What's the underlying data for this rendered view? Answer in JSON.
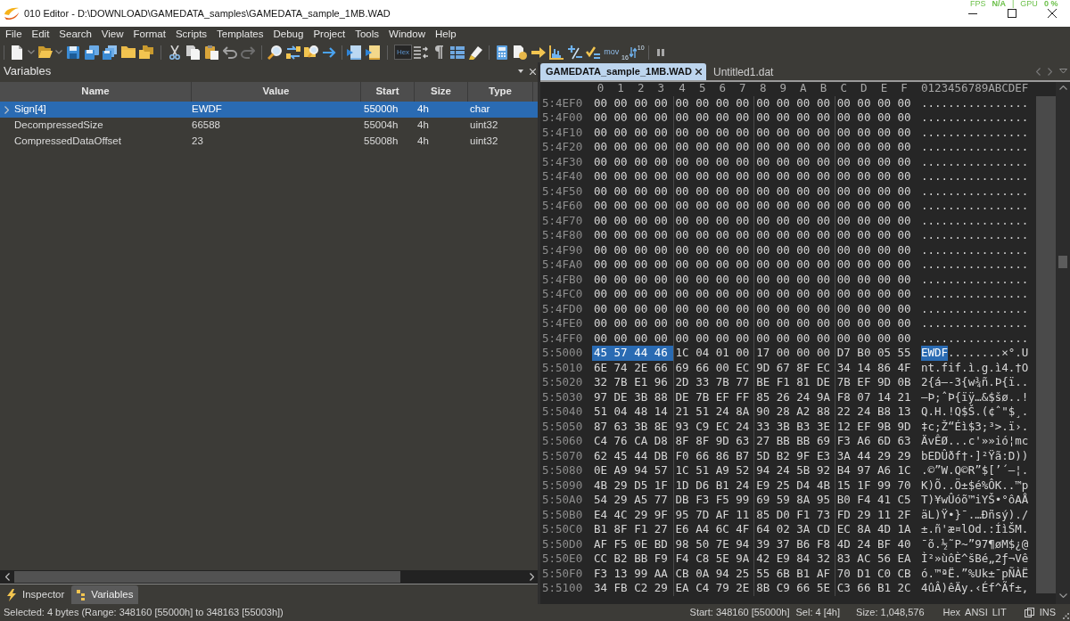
{
  "window": {
    "title": "010 Editor - D:\\DOWNLOAD\\GAMEDATA_samples\\GAMEDATA_sample_1MB.WAD"
  },
  "overlay": {
    "stats": [
      {
        "label": "FPS",
        "value": "N/A"
      },
      {
        "label": "GPU",
        "value": "0 %"
      }
    ],
    "separator": "|"
  },
  "menu": [
    "File",
    "Edit",
    "Search",
    "View",
    "Format",
    "Scripts",
    "Templates",
    "Debug",
    "Project",
    "Tools",
    "Window",
    "Help"
  ],
  "toolbar": {
    "hex_toggle": {
      "label": "Hex",
      "on": true
    },
    "mov_label": "mov",
    "base_labels": [
      "10",
      "16"
    ]
  },
  "variables_panel": {
    "title": "Variables",
    "columns": [
      "Name",
      "Value",
      "Start",
      "Size",
      "Type"
    ],
    "rows": [
      {
        "name": "Sign[4]",
        "value": "EWDF",
        "start": "55000h",
        "size": "4h",
        "type": "char",
        "expandable": true,
        "selected": true
      },
      {
        "name": "DecompressedSize",
        "value": "66588",
        "start": "55004h",
        "size": "4h",
        "type": "uint32",
        "expandable": false,
        "selected": false
      },
      {
        "name": "CompressedDataOffset",
        "value": "23",
        "start": "55008h",
        "size": "4h",
        "type": "uint32",
        "expandable": false,
        "selected": false
      }
    ]
  },
  "bottom_tabs": [
    {
      "label": "Inspector",
      "selected": false
    },
    {
      "label": "Variables",
      "selected": true
    }
  ],
  "editor_tabs": [
    {
      "label": "GAMEDATA_sample_1MB.WAD",
      "selected": true
    },
    {
      "label": "Untitled1.dat",
      "selected": false
    }
  ],
  "hex_view": {
    "column_headers": [
      "0",
      "1",
      "2",
      "3",
      "4",
      "5",
      "6",
      "7",
      "8",
      "9",
      "A",
      "B",
      "C",
      "D",
      "E",
      "F"
    ],
    "ascii_header": "0123456789ABCDEF",
    "rows": [
      {
        "address": "5:4EF0",
        "hex": [
          {
            "text": "00 00 00 00",
            "selected": false
          },
          {
            "text": "00 00 00 00",
            "selected": false
          },
          {
            "text": "00 00 00 00",
            "selected": false
          },
          {
            "text": "00 00 00 00",
            "selected": false
          }
        ],
        "ascii": [
          {
            "text": "................",
            "selected": false
          }
        ]
      },
      {
        "address": "5:4F00",
        "hex": [
          {
            "text": "00 00 00 00",
            "selected": false
          },
          {
            "text": "00 00 00 00",
            "selected": false
          },
          {
            "text": "00 00 00 00",
            "selected": false
          },
          {
            "text": "00 00 00 00",
            "selected": false
          }
        ],
        "ascii": [
          {
            "text": "................",
            "selected": false
          }
        ]
      },
      {
        "address": "5:4F10",
        "hex": [
          {
            "text": "00 00 00 00",
            "selected": false
          },
          {
            "text": "00 00 00 00",
            "selected": false
          },
          {
            "text": "00 00 00 00",
            "selected": false
          },
          {
            "text": "00 00 00 00",
            "selected": false
          }
        ],
        "ascii": [
          {
            "text": "................",
            "selected": false
          }
        ]
      },
      {
        "address": "5:4F20",
        "hex": [
          {
            "text": "00 00 00 00",
            "selected": false
          },
          {
            "text": "00 00 00 00",
            "selected": false
          },
          {
            "text": "00 00 00 00",
            "selected": false
          },
          {
            "text": "00 00 00 00",
            "selected": false
          }
        ],
        "ascii": [
          {
            "text": "................",
            "selected": false
          }
        ]
      },
      {
        "address": "5:4F30",
        "hex": [
          {
            "text": "00 00 00 00",
            "selected": false
          },
          {
            "text": "00 00 00 00",
            "selected": false
          },
          {
            "text": "00 00 00 00",
            "selected": false
          },
          {
            "text": "00 00 00 00",
            "selected": false
          }
        ],
        "ascii": [
          {
            "text": "................",
            "selected": false
          }
        ]
      },
      {
        "address": "5:4F40",
        "hex": [
          {
            "text": "00 00 00 00",
            "selected": false
          },
          {
            "text": "00 00 00 00",
            "selected": false
          },
          {
            "text": "00 00 00 00",
            "selected": false
          },
          {
            "text": "00 00 00 00",
            "selected": false
          }
        ],
        "ascii": [
          {
            "text": "................",
            "selected": false
          }
        ]
      },
      {
        "address": "5:4F50",
        "hex": [
          {
            "text": "00 00 00 00",
            "selected": false
          },
          {
            "text": "00 00 00 00",
            "selected": false
          },
          {
            "text": "00 00 00 00",
            "selected": false
          },
          {
            "text": "00 00 00 00",
            "selected": false
          }
        ],
        "ascii": [
          {
            "text": "................",
            "selected": false
          }
        ]
      },
      {
        "address": "5:4F60",
        "hex": [
          {
            "text": "00 00 00 00",
            "selected": false
          },
          {
            "text": "00 00 00 00",
            "selected": false
          },
          {
            "text": "00 00 00 00",
            "selected": false
          },
          {
            "text": "00 00 00 00",
            "selected": false
          }
        ],
        "ascii": [
          {
            "text": "................",
            "selected": false
          }
        ]
      },
      {
        "address": "5:4F70",
        "hex": [
          {
            "text": "00 00 00 00",
            "selected": false
          },
          {
            "text": "00 00 00 00",
            "selected": false
          },
          {
            "text": "00 00 00 00",
            "selected": false
          },
          {
            "text": "00 00 00 00",
            "selected": false
          }
        ],
        "ascii": [
          {
            "text": "................",
            "selected": false
          }
        ]
      },
      {
        "address": "5:4F80",
        "hex": [
          {
            "text": "00 00 00 00",
            "selected": false
          },
          {
            "text": "00 00 00 00",
            "selected": false
          },
          {
            "text": "00 00 00 00",
            "selected": false
          },
          {
            "text": "00 00 00 00",
            "selected": false
          }
        ],
        "ascii": [
          {
            "text": "................",
            "selected": false
          }
        ]
      },
      {
        "address": "5:4F90",
        "hex": [
          {
            "text": "00 00 00 00",
            "selected": false
          },
          {
            "text": "00 00 00 00",
            "selected": false
          },
          {
            "text": "00 00 00 00",
            "selected": false
          },
          {
            "text": "00 00 00 00",
            "selected": false
          }
        ],
        "ascii": [
          {
            "text": "................",
            "selected": false
          }
        ]
      },
      {
        "address": "5:4FA0",
        "hex": [
          {
            "text": "00 00 00 00",
            "selected": false
          },
          {
            "text": "00 00 00 00",
            "selected": false
          },
          {
            "text": "00 00 00 00",
            "selected": false
          },
          {
            "text": "00 00 00 00",
            "selected": false
          }
        ],
        "ascii": [
          {
            "text": "................",
            "selected": false
          }
        ]
      },
      {
        "address": "5:4FB0",
        "hex": [
          {
            "text": "00 00 00 00",
            "selected": false
          },
          {
            "text": "00 00 00 00",
            "selected": false
          },
          {
            "text": "00 00 00 00",
            "selected": false
          },
          {
            "text": "00 00 00 00",
            "selected": false
          }
        ],
        "ascii": [
          {
            "text": "................",
            "selected": false
          }
        ]
      },
      {
        "address": "5:4FC0",
        "hex": [
          {
            "text": "00 00 00 00",
            "selected": false
          },
          {
            "text": "00 00 00 00",
            "selected": false
          },
          {
            "text": "00 00 00 00",
            "selected": false
          },
          {
            "text": "00 00 00 00",
            "selected": false
          }
        ],
        "ascii": [
          {
            "text": "................",
            "selected": false
          }
        ]
      },
      {
        "address": "5:4FD0",
        "hex": [
          {
            "text": "00 00 00 00",
            "selected": false
          },
          {
            "text": "00 00 00 00",
            "selected": false
          },
          {
            "text": "00 00 00 00",
            "selected": false
          },
          {
            "text": "00 00 00 00",
            "selected": false
          }
        ],
        "ascii": [
          {
            "text": "................",
            "selected": false
          }
        ]
      },
      {
        "address": "5:4FE0",
        "hex": [
          {
            "text": "00 00 00 00",
            "selected": false
          },
          {
            "text": "00 00 00 00",
            "selected": false
          },
          {
            "text": "00 00 00 00",
            "selected": false
          },
          {
            "text": "00 00 00 00",
            "selected": false
          }
        ],
        "ascii": [
          {
            "text": "................",
            "selected": false
          }
        ]
      },
      {
        "address": "5:4FF0",
        "hex": [
          {
            "text": "00 00 00 00",
            "selected": false
          },
          {
            "text": "00 00 00 00",
            "selected": false
          },
          {
            "text": "00 00 00 00",
            "selected": false
          },
          {
            "text": "00 00 00 00",
            "selected": false
          }
        ],
        "ascii": [
          {
            "text": "................",
            "selected": false
          }
        ]
      },
      {
        "address": "5:5000",
        "hex": [
          {
            "text": "45 57 44 46",
            "selected": true
          },
          {
            "text": "1C 04 01 00",
            "selected": false
          },
          {
            "text": "17 00 00 00",
            "selected": false
          },
          {
            "text": "D7 B0 05 55",
            "selected": false
          }
        ],
        "ascii": [
          {
            "text": "EWDF",
            "selected": true
          },
          {
            "text": "........×°.U",
            "selected": false
          }
        ]
      },
      {
        "address": "5:5010",
        "hex": [
          {
            "text": "6E 74 2E 66",
            "selected": false
          },
          {
            "text": "69 66 00 EC",
            "selected": false
          },
          {
            "text": "9D 67 8F EC",
            "selected": false
          },
          {
            "text": "34 14 86 4F",
            "selected": false
          }
        ],
        "ascii": [
          {
            "text": "nt.fif.ì.g.ì4.†O",
            "selected": false
          }
        ]
      },
      {
        "address": "5:5020",
        "hex": [
          {
            "text": "32 7B E1 96",
            "selected": false
          },
          {
            "text": "2D 33 7B 77",
            "selected": false
          },
          {
            "text": "BE F1 81 DE",
            "selected": false
          },
          {
            "text": "7B EF 9D 0B",
            "selected": false
          }
        ],
        "ascii": [
          {
            "text": "2{á–-3{w¾ñ.Þ{ï..",
            "selected": false
          }
        ]
      },
      {
        "address": "5:5030",
        "hex": [
          {
            "text": "97 DE 3B 88",
            "selected": false
          },
          {
            "text": "DE 7B EF FF",
            "selected": false
          },
          {
            "text": "85 26 24 9A",
            "selected": false
          },
          {
            "text": "F8 07 14 21",
            "selected": false
          }
        ],
        "ascii": [
          {
            "text": "—Þ;ˆÞ{ïÿ…&$šø..!",
            "selected": false
          }
        ]
      },
      {
        "address": "5:5040",
        "hex": [
          {
            "text": "51 04 48 14",
            "selected": false
          },
          {
            "text": "21 51 24 8A",
            "selected": false
          },
          {
            "text": "90 28 A2 88",
            "selected": false
          },
          {
            "text": "22 24 B8 13",
            "selected": false
          }
        ],
        "ascii": [
          {
            "text": "Q.H.!Q$Š.(¢ˆ\"$¸.",
            "selected": false
          }
        ]
      },
      {
        "address": "5:5050",
        "hex": [
          {
            "text": "87 63 3B 8E",
            "selected": false
          },
          {
            "text": "93 C9 EC 24",
            "selected": false
          },
          {
            "text": "33 3B B3 3E",
            "selected": false
          },
          {
            "text": "12 EF 9B 9D",
            "selected": false
          }
        ],
        "ascii": [
          {
            "text": "‡c;Ž“Éì$3;³>.ï›.",
            "selected": false
          }
        ]
      },
      {
        "address": "5:5060",
        "hex": [
          {
            "text": "C4 76 CA D8",
            "selected": false
          },
          {
            "text": "8F 8F 9D 63",
            "selected": false
          },
          {
            "text": "27 BB BB 69",
            "selected": false
          },
          {
            "text": "F3 A6 6D 63",
            "selected": false
          }
        ],
        "ascii": [
          {
            "text": "ÄvÊØ...c'»»ió¦mc",
            "selected": false
          }
        ]
      },
      {
        "address": "5:5070",
        "hex": [
          {
            "text": "62 45 44 DB",
            "selected": false
          },
          {
            "text": "F0 66 86 B7",
            "selected": false
          },
          {
            "text": "5D B2 9F E3",
            "selected": false
          },
          {
            "text": "3A 44 29 29",
            "selected": false
          }
        ],
        "ascii": [
          {
            "text": "bEDÛðf†·]²Ÿã:D))",
            "selected": false
          }
        ]
      },
      {
        "address": "5:5080",
        "hex": [
          {
            "text": "0E A9 94 57",
            "selected": false
          },
          {
            "text": "1C 51 A9 52",
            "selected": false
          },
          {
            "text": "94 24 5B 92",
            "selected": false
          },
          {
            "text": "B4 97 A6 1C",
            "selected": false
          }
        ],
        "ascii": [
          {
            "text": ".©”W.Q©R”$[’´—¦.",
            "selected": false
          }
        ]
      },
      {
        "address": "5:5090",
        "hex": [
          {
            "text": "4B 29 D5 1F",
            "selected": false
          },
          {
            "text": "1D D6 B1 24",
            "selected": false
          },
          {
            "text": "E9 25 D4 4B",
            "selected": false
          },
          {
            "text": "15 1F 99 70",
            "selected": false
          }
        ],
        "ascii": [
          {
            "text": "K)Õ..Ö±$é%ÔK..™p",
            "selected": false
          }
        ]
      },
      {
        "address": "5:50A0",
        "hex": [
          {
            "text": "54 29 A5 77",
            "selected": false
          },
          {
            "text": "DB F3 F5 99",
            "selected": false
          },
          {
            "text": "69 59 8A 95",
            "selected": false
          },
          {
            "text": "B0 F4 41 C5",
            "selected": false
          }
        ],
        "ascii": [
          {
            "text": "T)¥wÛóõ™iYŠ•°ôAÅ",
            "selected": false
          }
        ]
      },
      {
        "address": "5:50B0",
        "hex": [
          {
            "text": "E4 4C 29 9F",
            "selected": false
          },
          {
            "text": "95 7D AF 11",
            "selected": false
          },
          {
            "text": "85 D0 F1 73",
            "selected": false
          },
          {
            "text": "FD 29 11 2F",
            "selected": false
          }
        ],
        "ascii": [
          {
            "text": "äL)Ÿ•}¯.…Ðñsý)./",
            "selected": false
          }
        ]
      },
      {
        "address": "5:50C0",
        "hex": [
          {
            "text": "B1 8F F1 27",
            "selected": false
          },
          {
            "text": "E6 A4 6C 4F",
            "selected": false
          },
          {
            "text": "64 02 3A CD",
            "selected": false
          },
          {
            "text": "EC 8A 4D 1A",
            "selected": false
          }
        ],
        "ascii": [
          {
            "text": "±.ñ'æ¤lOd.:ÍìŠM.",
            "selected": false
          }
        ]
      },
      {
        "address": "5:50D0",
        "hex": [
          {
            "text": "AF F5 0E BD",
            "selected": false
          },
          {
            "text": "98 50 7E 94",
            "selected": false
          },
          {
            "text": "39 37 B6 F8",
            "selected": false
          },
          {
            "text": "4D 24 BF 40",
            "selected": false
          }
        ],
        "ascii": [
          {
            "text": "¯õ.½˜P~”97¶øM$¿@",
            "selected": false
          }
        ]
      },
      {
        "address": "5:50E0",
        "hex": [
          {
            "text": "CC B2 BB F9",
            "selected": false
          },
          {
            "text": "F4 C8 5E 9A",
            "selected": false
          },
          {
            "text": "42 E9 84 32",
            "selected": false
          },
          {
            "text": "83 AC 56 EA",
            "selected": false
          }
        ],
        "ascii": [
          {
            "text": "Ì²»ùôÈ^šBé„2ƒ¬Vê",
            "selected": false
          }
        ]
      },
      {
        "address": "5:50F0",
        "hex": [
          {
            "text": "F3 13 99 AA",
            "selected": false
          },
          {
            "text": "CB 0A 94 25",
            "selected": false
          },
          {
            "text": "55 6B B1 AF",
            "selected": false
          },
          {
            "text": "70 D1 C0 CB",
            "selected": false
          }
        ],
        "ascii": [
          {
            "text": "ó.™ªË.”%Uk±¯pÑÀË",
            "selected": false
          }
        ]
      },
      {
        "address": "5:5100",
        "hex": [
          {
            "text": "34 FB C2 29",
            "selected": false
          },
          {
            "text": "EA C4 79 2E",
            "selected": false
          },
          {
            "text": "8B C9 66 5E",
            "selected": false
          },
          {
            "text": "C3 66 B1 2C",
            "selected": false
          }
        ],
        "ascii": [
          {
            "text": "4ûÂ)êÄy.‹Éf^Ãf±,",
            "selected": false
          }
        ]
      }
    ]
  },
  "status_bar": {
    "selection": "Selected: 4 bytes (Range: 348160 [55000h] to 348163 [55003h])",
    "start": "Start: 348160 [55000h]",
    "sel": "Sel: 4 [4h]",
    "size": "Size: 1,048,576",
    "modes": [
      "Hex",
      "ANSI",
      "LIT"
    ],
    "insert_mode": "INS"
  }
}
